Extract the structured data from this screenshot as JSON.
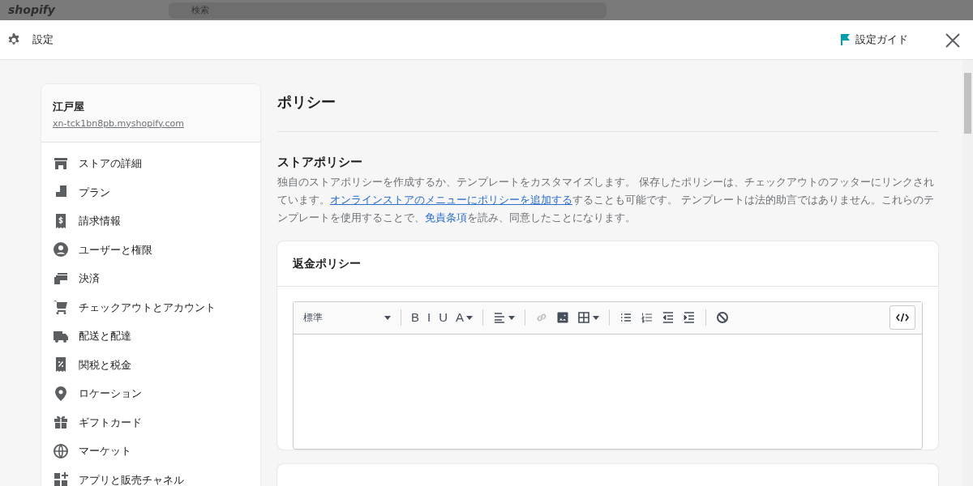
{
  "backdrop": {
    "logo": "shopify",
    "search": {
      "placeholder": "検索"
    }
  },
  "header": {
    "title": "設定",
    "guide": "設定ガイド"
  },
  "store": {
    "name": "江戸屋",
    "domain": "xn-tck1bn8pb.myshopify.com"
  },
  "sidebar": {
    "items": [
      {
        "label": "ストアの詳細"
      },
      {
        "label": "プラン"
      },
      {
        "label": "請求情報"
      },
      {
        "label": "ユーザーと権限"
      },
      {
        "label": "決済"
      },
      {
        "label": "チェックアウトとアカウント"
      },
      {
        "label": "配送と配達"
      },
      {
        "label": "関税と税金"
      },
      {
        "label": "ロケーション"
      },
      {
        "label": "ギフトカード"
      },
      {
        "label": "マーケット"
      },
      {
        "label": "アプリと販売チャネル"
      }
    ]
  },
  "page": {
    "title": "ポリシー",
    "section_title": "ストアポリシー",
    "description": [
      {
        "text": "独自のストアポリシーを作成するか、テンプレートをカスタマイズします。 保存したポリシーは、チェックアウトのフッターにリンクされています。"
      },
      {
        "kind": "link",
        "text": "オンラインストアのメニューにポリシーを追加する",
        "underline": true
      },
      {
        "text": "することも可能です。 テンプレートは法的助言ではありません。これらのテンプレートを使用することで、"
      },
      {
        "kind": "link",
        "text": "免責条項",
        "underline": false
      },
      {
        "text": "を読み、同意したことになります。"
      }
    ]
  },
  "policy_card": {
    "title": "返金ポリシー",
    "editor": {
      "toolbar": [
        {
          "kind": "select",
          "label": "標準"
        },
        {
          "kind": "separator"
        },
        {
          "kind": "letter",
          "label": "B",
          "dropdown": false
        },
        {
          "kind": "letter",
          "label": "I",
          "dropdown": false
        },
        {
          "kind": "letter",
          "label": "U",
          "dropdown": false
        },
        {
          "kind": "letter",
          "label": "A",
          "dropdown": true
        },
        {
          "kind": "separator"
        },
        {
          "kind": "icon",
          "dropdown": true,
          "disabled": false
        },
        {
          "kind": "separator"
        },
        {
          "kind": "icon",
          "dropdown": false,
          "disabled": true
        },
        {
          "kind": "icon",
          "dropdown": false,
          "disabled": false
        },
        {
          "kind": "icon",
          "dropdown": true,
          "disabled": false
        },
        {
          "kind": "separator"
        },
        {
          "kind": "icon",
          "dropdown": false,
          "disabled": false
        },
        {
          "kind": "icon",
          "dropdown": false,
          "disabled": false
        },
        {
          "kind": "icon",
          "dropdown": false,
          "disabled": false
        },
        {
          "kind": "icon",
          "dropdown": false,
          "disabled": false
        },
        {
          "kind": "separator"
        },
        {
          "kind": "icon",
          "dropdown": false,
          "disabled": false
        }
      ],
      "code_toggle": {
        "selected": false
      }
    }
  }
}
